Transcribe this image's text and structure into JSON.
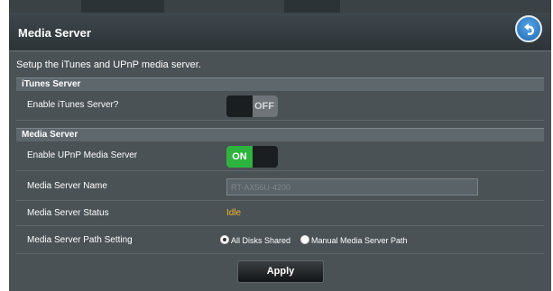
{
  "header": {
    "title": "Media Server",
    "back_icon": "back-arrow-icon"
  },
  "intro_text": "Setup the iTunes and UPnP media server.",
  "itunes_section": {
    "title": "iTunes Server",
    "enable_label": "Enable iTunes Server?",
    "toggle_state": "OFF"
  },
  "media_section": {
    "title": "Media Server",
    "upnp_label": "Enable UPnP Media Server",
    "upnp_toggle_state": "ON",
    "name_label": "Media Server Name",
    "name_value": "RT-AX56U-4200",
    "status_label": "Media Server Status",
    "status_value": "Idle",
    "path_label": "Media Server Path Setting",
    "path_options": [
      "All Disks Shared",
      "Manual Media Server Path"
    ],
    "path_selected": "All Disks Shared"
  },
  "apply_label": "Apply",
  "colors": {
    "status": "#f1b52d",
    "toggle_on": "#2fb33f",
    "background": "#4a5256",
    "accent_blue": "#1f67b0"
  }
}
